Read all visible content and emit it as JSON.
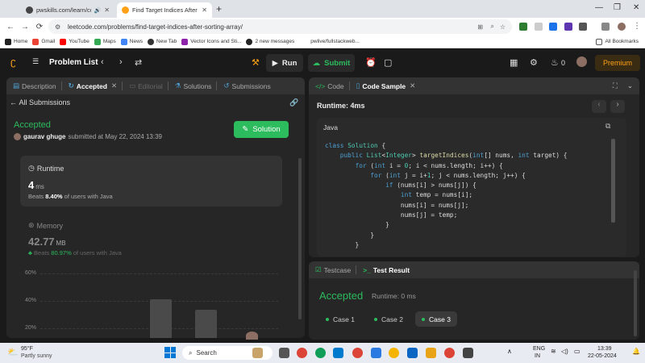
{
  "browser": {
    "tabs": [
      {
        "title": "pwskills.com/learn/course/..."
      },
      {
        "title": "Find Target Indices After Sorting"
      }
    ],
    "new_tab": "+",
    "url": "leetcode.com/problems/find-target-indices-after-sorting-array/",
    "bookmarks": [
      "Home",
      "Gmail",
      "YouTube",
      "Maps",
      "News",
      "New Tab",
      "Vector Icons and Sti...",
      "2 new messages",
      "pwlive/fullstackweb...",
      "All Bookmarks"
    ]
  },
  "header": {
    "problem_list": "Problem List",
    "run": "Run",
    "submit": "Submit",
    "fire_count": "0",
    "premium": "Premium"
  },
  "left_panel": {
    "tabs": [
      "Description",
      "Accepted",
      "Editorial",
      "Solutions",
      "Submissions"
    ],
    "all_submissions": "All Submissions",
    "status": "Accepted",
    "user": "gaurav ghuge",
    "submitted": "submitted at May 22, 2024 13:39",
    "solution_btn": "Solution",
    "runtime": {
      "label": "Runtime",
      "value": "4",
      "unit": "ms",
      "beats_prefix": "Beats",
      "beats_pct": "8.40%",
      "beats_suffix": "of users with Java"
    },
    "memory": {
      "label": "Memory",
      "value": "42.77",
      "unit": "MB",
      "beats_prefix": "Beats",
      "beats_pct": "80.97%",
      "beats_suffix": "of users with Java"
    },
    "y_ticks": [
      "60%",
      "40%",
      "20%"
    ]
  },
  "code_panel": {
    "tabs": [
      "Code",
      "Code Sample"
    ],
    "runtime": "Runtime: 4ms",
    "language": "Java"
  },
  "test_panel": {
    "tabs": [
      "Testcase",
      "Test Result"
    ],
    "status": "Accepted",
    "runtime": "Runtime: 0 ms",
    "cases": [
      "Case 1",
      "Case 2",
      "Case 3"
    ]
  },
  "taskbar": {
    "weather_temp": "95°F",
    "weather_desc": "Partly sunny",
    "search": "Search",
    "lang1": "ENG",
    "lang2": "IN",
    "time": "13:39",
    "date": "22-05-2024"
  }
}
